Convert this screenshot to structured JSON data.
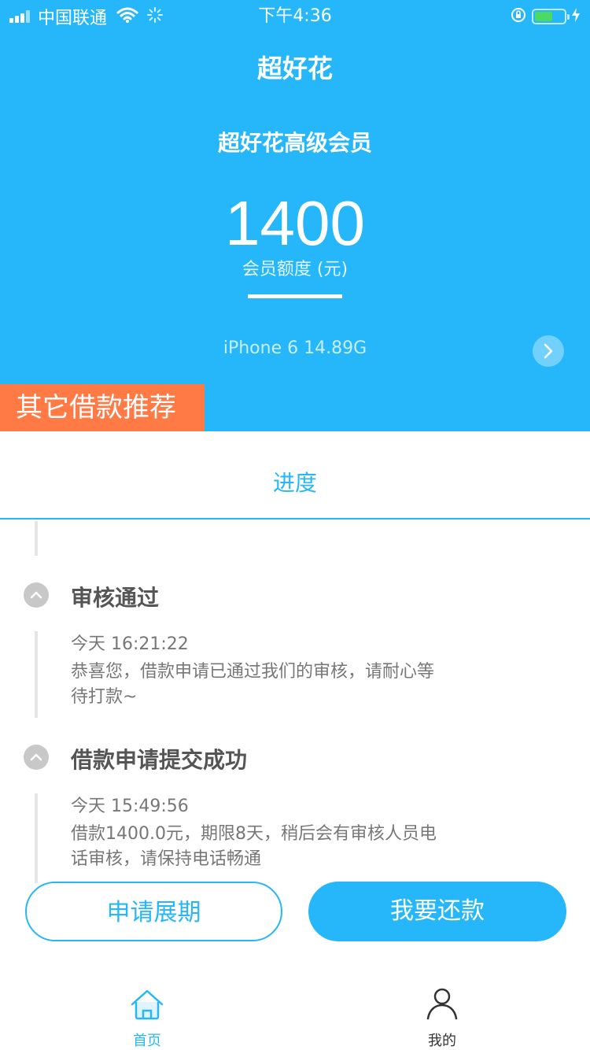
{
  "status_bar": {
    "carrier": "中国联通",
    "time": "下午4:36"
  },
  "header": {
    "app_title": "超好花",
    "member_title": "超好花高级会员",
    "limit_amount": "1400",
    "limit_label": "会员额度 (元)",
    "device_info": "iPhone 6  14.89G",
    "recommend_tag": "其它借款推荐"
  },
  "tab": {
    "label": "进度"
  },
  "timeline": [
    {
      "title": "审核通过",
      "time": "今天 16:21:22",
      "desc": "恭喜您，借款申请已通过我们的审核，请耐心等待打款~"
    },
    {
      "title": "借款申请提交成功",
      "time": "今天 15:49:56",
      "desc": "借款1400.0元，期限8天，稍后会有审核人员电话审核，请保持电话畅通"
    }
  ],
  "buttons": {
    "extend": "申请展期",
    "repay": "我要还款"
  },
  "bottom_nav": [
    {
      "label": "首页",
      "icon": "home-icon",
      "active": true
    },
    {
      "label": "我的",
      "icon": "user-icon",
      "active": false
    }
  ],
  "colors": {
    "primary": "#26B7FA",
    "accent_tag": "#FF7A45",
    "battery": "#4CD964"
  }
}
